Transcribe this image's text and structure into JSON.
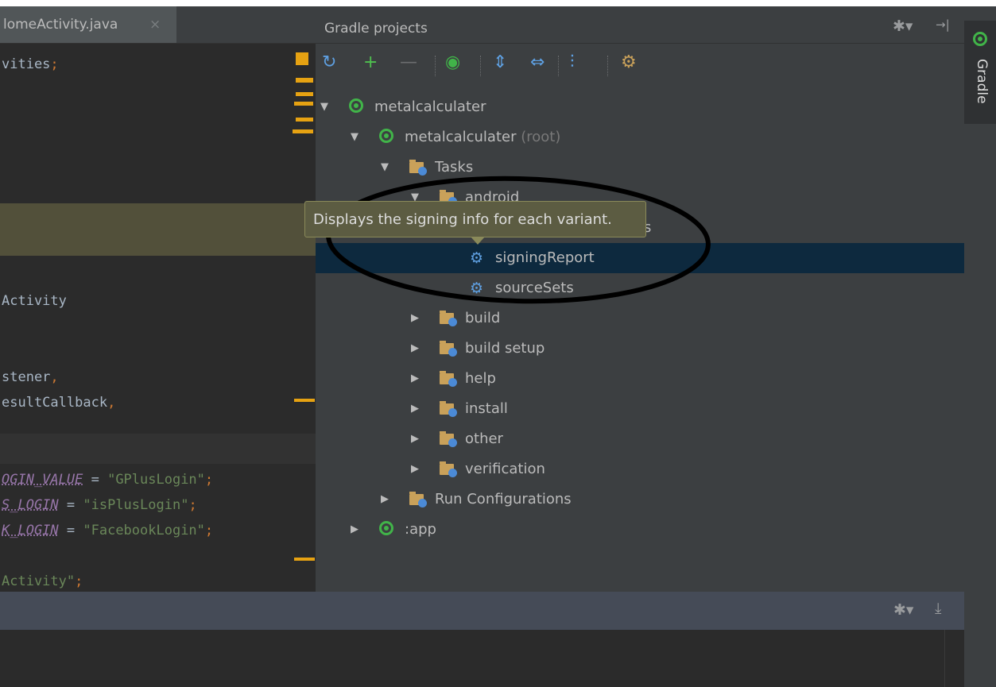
{
  "editor": {
    "tab_label": "lomeActivity.java",
    "tab_close": "×",
    "lines": [
      {
        "parts": [
          {
            "t": "vities",
            "c": ""
          },
          {
            "t": ";",
            "c": "kw-punc"
          }
        ]
      },
      {
        "parts": [
          {
            "t": "Activity",
            "c": ""
          }
        ]
      },
      {
        "parts": [
          {
            "t": "stener",
            "c": ""
          },
          {
            "t": ",",
            "c": "kw-punc"
          }
        ]
      },
      {
        "parts": [
          {
            "t": "esultCallback",
            "c": ""
          },
          {
            "t": ",",
            "c": "kw-punc"
          }
        ]
      },
      {
        "parts": [
          {
            "t": "OGIN_VALUE",
            "c": "kw-const"
          },
          {
            "t": " = ",
            "c": "kw-op"
          },
          {
            "t": "\"GPlusLogin\"",
            "c": "kw-str"
          },
          {
            "t": ";",
            "c": "kw-punc"
          }
        ]
      },
      {
        "parts": [
          {
            "t": "S_LOGIN",
            "c": "kw-const"
          },
          {
            "t": " = ",
            "c": "kw-op"
          },
          {
            "t": "\"isPlusLogin\"",
            "c": "kw-str"
          },
          {
            "t": ";",
            "c": "kw-punc"
          }
        ]
      },
      {
        "parts": [
          {
            "t": "K_LOGIN",
            "c": "kw-const"
          },
          {
            "t": " = ",
            "c": "kw-op"
          },
          {
            "t": "\"FacebookLogin\"",
            "c": "kw-str"
          },
          {
            "t": ";",
            "c": "kw-punc"
          }
        ]
      },
      {
        "parts": [
          {
            "t": "Activity\"",
            "c": "kw-str"
          },
          {
            "t": ";",
            "c": "kw-punc"
          }
        ]
      }
    ]
  },
  "gradle_panel": {
    "title": "Gradle projects",
    "header_icons": {
      "settings": "✱▾",
      "hide": "→|"
    },
    "toolbar": [
      {
        "name": "refresh-icon",
        "glyph": "↻",
        "color": "#5e9fe0"
      },
      {
        "name": "add-icon",
        "glyph": "+",
        "color": "#4fc04f"
      },
      {
        "name": "remove-icon",
        "glyph": "—",
        "color": "#6b6d6f"
      },
      {
        "name": "execute-task-icon",
        "glyph": "◉",
        "color": "#41b449"
      },
      {
        "name": "expand-all-icon",
        "glyph": "⇕",
        "color": "#5e9fe0"
      },
      {
        "name": "collapse-all-icon",
        "glyph": "⇔",
        "color": "#5e9fe0"
      },
      {
        "name": "toggle-offline-icon",
        "glyph": "⫶",
        "color": "#5e9fe0"
      },
      {
        "name": "gradle-settings-icon",
        "glyph": "⚙",
        "color": "#c9a15a"
      }
    ],
    "tree": [
      {
        "key": "metalcalculater",
        "label": "metalcalculater",
        "suffix": "",
        "icon": "gradle",
        "arrow": "▼",
        "selected": false
      },
      {
        "key": "metalcalculater-root",
        "label": "metalcalculater",
        "suffix": " (root)",
        "icon": "gradle",
        "arrow": "▼",
        "selected": false
      },
      {
        "key": "tasks",
        "label": "Tasks",
        "suffix": "",
        "icon": "folder",
        "arrow": "▼",
        "selected": false
      },
      {
        "key": "android",
        "label": "android",
        "suffix": "",
        "icon": "folder",
        "arrow": "▼",
        "selected": false
      },
      {
        "key": "android-dependencies",
        "label": "androidDependencies",
        "suffix": "",
        "icon": "gear",
        "arrow": "",
        "selected": false
      },
      {
        "key": "signing-report",
        "label": "signingReport",
        "suffix": "",
        "icon": "gear",
        "arrow": "",
        "selected": true
      },
      {
        "key": "source-sets",
        "label": "sourceSets",
        "suffix": "",
        "icon": "gear",
        "arrow": "",
        "selected": false
      },
      {
        "key": "build",
        "label": "build",
        "suffix": "",
        "icon": "folder",
        "arrow": "▶",
        "selected": false
      },
      {
        "key": "build-setup",
        "label": "build setup",
        "suffix": "",
        "icon": "folder",
        "arrow": "▶",
        "selected": false
      },
      {
        "key": "help",
        "label": "help",
        "suffix": "",
        "icon": "folder",
        "arrow": "▶",
        "selected": false
      },
      {
        "key": "install",
        "label": "install",
        "suffix": "",
        "icon": "folder",
        "arrow": "▶",
        "selected": false
      },
      {
        "key": "other",
        "label": "other",
        "suffix": "",
        "icon": "folder",
        "arrow": "▶",
        "selected": false
      },
      {
        "key": "verification",
        "label": "verification",
        "suffix": "",
        "icon": "folder",
        "arrow": "▶",
        "selected": false
      },
      {
        "key": "run-configurations",
        "label": "Run Configurations",
        "suffix": "",
        "icon": "folder",
        "arrow": "▶",
        "selected": false
      },
      {
        "key": "app",
        "label": ":app",
        "suffix": "",
        "icon": "gradle",
        "arrow": "▶",
        "selected": false
      }
    ],
    "tooltip": "Displays the signing info for each variant."
  },
  "side_tab": {
    "label": "Gradle"
  },
  "bottom_bar": {
    "icons": {
      "settings": "✱▾",
      "pin": "⤓"
    }
  }
}
